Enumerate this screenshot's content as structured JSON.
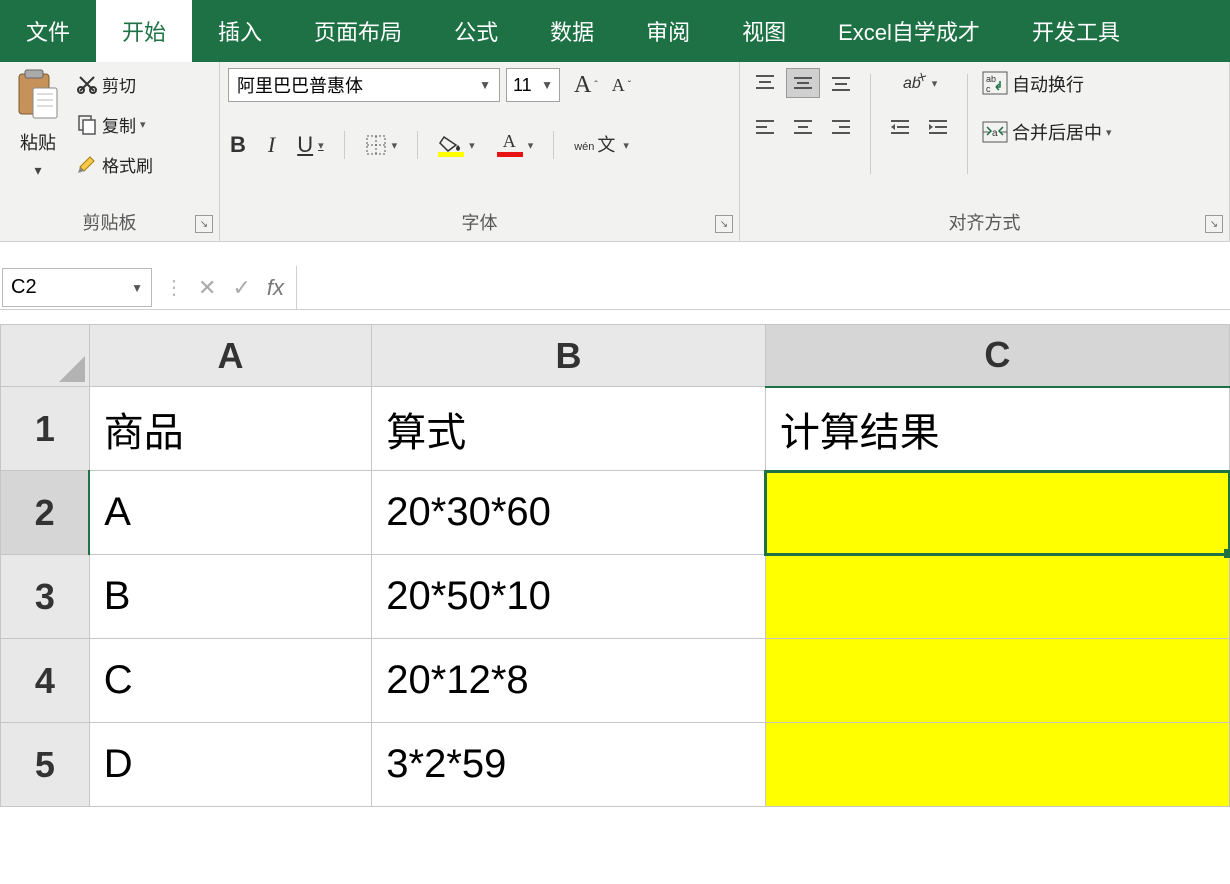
{
  "tabs": {
    "file": "文件",
    "home": "开始",
    "insert": "插入",
    "layout": "页面布局",
    "formula": "公式",
    "data": "数据",
    "review": "审阅",
    "view": "视图",
    "custom": "Excel自学成才",
    "developer": "开发工具"
  },
  "clipboard": {
    "paste": "粘贴",
    "cut": "剪切",
    "copy": "复制",
    "format_painter": "格式刷",
    "group_label": "剪贴板"
  },
  "font": {
    "name": "阿里巴巴普惠体",
    "size": "11",
    "group_label": "字体",
    "bold": "B",
    "italic": "I",
    "underline": "U",
    "wen": "wén",
    "wen_char": "文"
  },
  "align": {
    "group_label": "对齐方式",
    "wrap": "自动换行",
    "merge": "合并后居中"
  },
  "namebox": {
    "ref": "C2",
    "fx": "fx"
  },
  "grid": {
    "cols": [
      "A",
      "B",
      "C"
    ],
    "row_headers": [
      "1",
      "2",
      "3",
      "4",
      "5"
    ],
    "header_row": {
      "A": "商品",
      "B": "算式",
      "C": "计算结果"
    },
    "rows": [
      {
        "A": "A",
        "B": "20*30*60",
        "C": ""
      },
      {
        "A": "B",
        "B": "20*50*10",
        "C": ""
      },
      {
        "A": "C",
        "B": "20*12*8",
        "C": ""
      },
      {
        "A": "D",
        "B": "3*2*59",
        "C": ""
      }
    ],
    "selected": "C2"
  },
  "icons": {
    "caret": "▾",
    "dropdown": "▼",
    "dots": "⋮",
    "times": "✕",
    "check": "✓"
  }
}
